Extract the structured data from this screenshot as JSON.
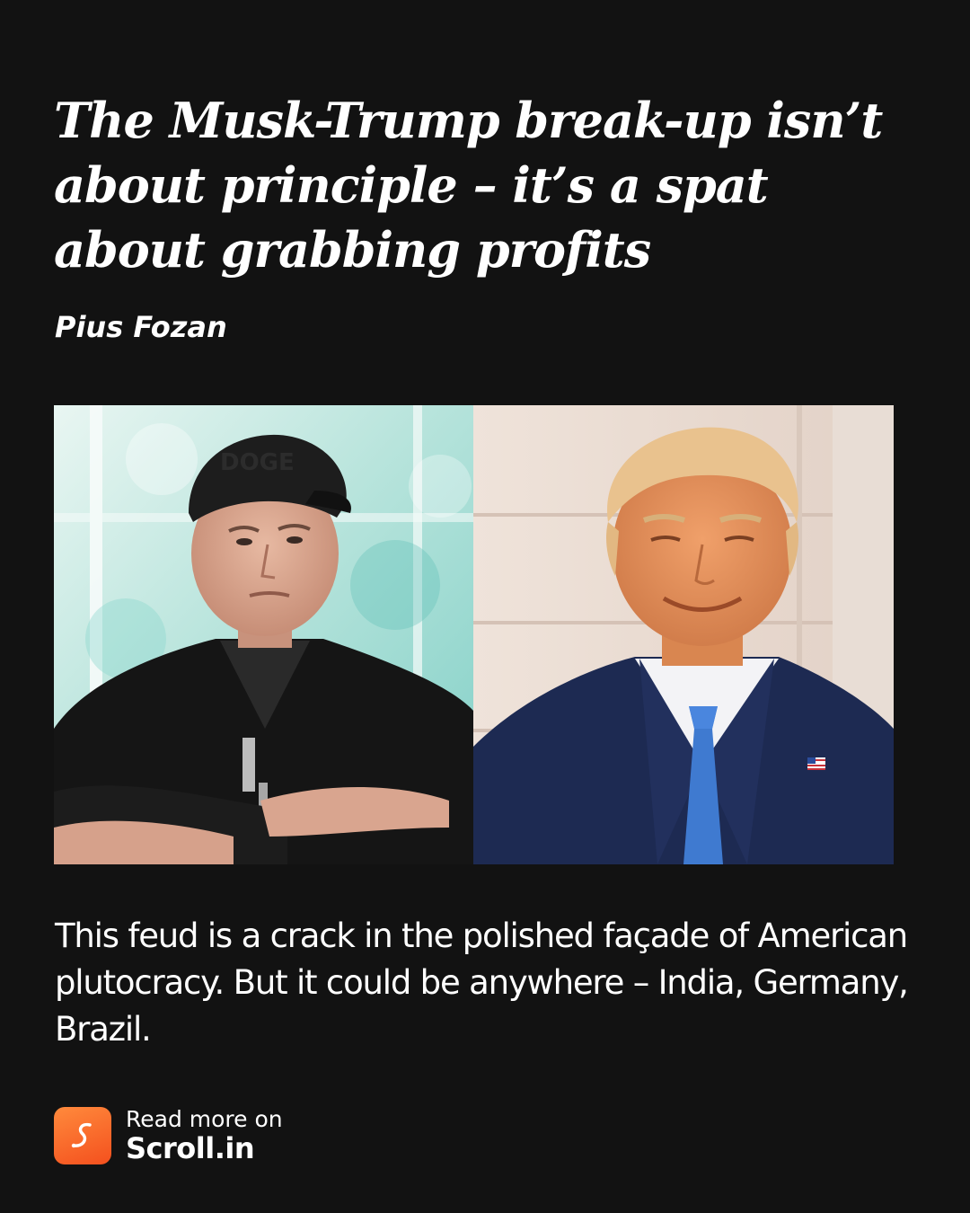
{
  "article": {
    "headline": "The Musk-Trump break-up isn’t about principle – it’s a spat about grabbing profits",
    "author": "Pius Fozan",
    "summary": "This feud is a crack in the polished façade of American plutocracy. But it could be anywhere – India, Germany, Brazil."
  },
  "photos": {
    "left_cap_text": "DOGE"
  },
  "cta": {
    "line1": "Read more on",
    "line2": "Scroll.in"
  },
  "colors": {
    "background": "#121212",
    "text": "#ffffff",
    "logo_gradient_start": "#ff8a3c",
    "logo_gradient_end": "#f4501e"
  },
  "icons": {
    "logo": "scroll-logo-icon",
    "flag_pin": "us-flag-pin-icon"
  }
}
